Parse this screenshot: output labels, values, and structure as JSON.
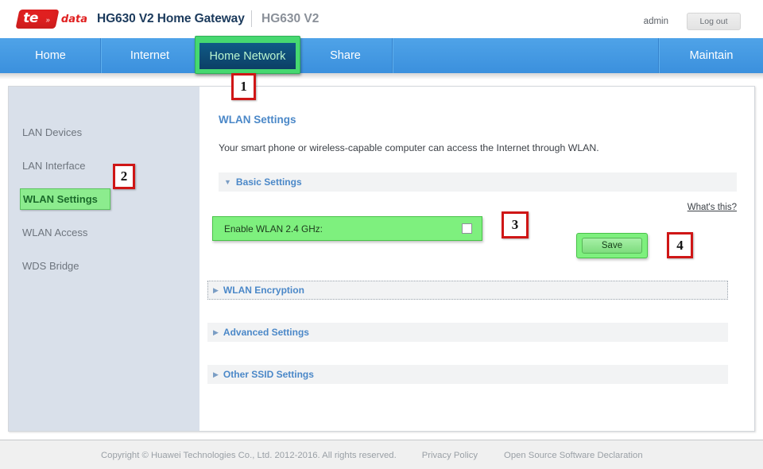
{
  "header": {
    "logo_main": "te",
    "logo_dots": "»",
    "logo_suffix": "data",
    "title": "HG630 V2 Home Gateway",
    "model": "HG630 V2",
    "user": "admin",
    "logout_label": "Log out"
  },
  "nav": {
    "items": [
      {
        "label": "Home",
        "active": false
      },
      {
        "label": "Internet",
        "active": false
      },
      {
        "label": "Home Network",
        "active": true
      },
      {
        "label": "Share",
        "active": false
      },
      {
        "label": "Maintain",
        "active": false
      }
    ]
  },
  "sidebar": {
    "items": [
      {
        "label": "LAN Devices",
        "active": false
      },
      {
        "label": "LAN Interface",
        "active": false
      },
      {
        "label": "WLAN Settings",
        "active": true
      },
      {
        "label": "WLAN Access",
        "active": false
      },
      {
        "label": "WDS Bridge",
        "active": false
      }
    ]
  },
  "content": {
    "title": "WLAN Settings",
    "description": "Your smart phone or wireless-capable computer can access the Internet through WLAN.",
    "basic_settings": {
      "label": "Basic Settings",
      "triangle": "▼",
      "whats_this": "What's this?",
      "enable_wlan_label": "Enable WLAN 2.4 GHz:",
      "enable_wlan_checked": false,
      "save_label": "Save"
    },
    "sections": [
      {
        "label": "WLAN Encryption",
        "triangle": "▶",
        "expanded": false,
        "dotted_outline": true
      },
      {
        "label": "Advanced Settings",
        "triangle": "▶",
        "expanded": false,
        "dotted_outline": false
      },
      {
        "label": "Other SSID Settings",
        "triangle": "▶",
        "expanded": false,
        "dotted_outline": false
      }
    ]
  },
  "footer": {
    "copyright": "Copyright © Huawei Technologies Co., Ltd. 2012-2016. All rights reserved.",
    "privacy_policy": "Privacy Policy",
    "open_source": "Open Source Software Declaration"
  },
  "callouts": [
    {
      "number": "1"
    },
    {
      "number": "2"
    },
    {
      "number": "3"
    },
    {
      "number": "4"
    }
  ],
  "colors": {
    "nav_blue": "#3b90dd",
    "active_tab_dark": "#0c3f66",
    "highlight_green": "#46d870",
    "row_green": "#7ef07e",
    "callout_red": "#cf1616",
    "link_blue": "#4b88c8",
    "sidebar_bg": "#d9e0ea"
  }
}
